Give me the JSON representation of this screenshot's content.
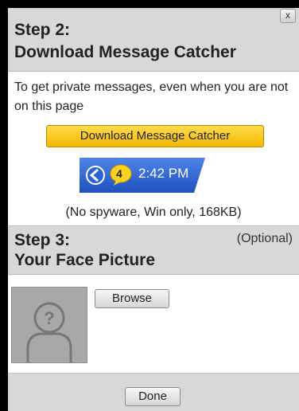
{
  "step2": {
    "title_line1": "Step 2:",
    "title_line2": "Download Message Catcher",
    "close_label": "x",
    "description": "To get private messages, even when you are not on this page",
    "download_button": "Download Message Catcher",
    "taskbar_count": "4",
    "taskbar_time": "2:42 PM",
    "specs": "(No spyware, Win only, 168KB)"
  },
  "step3": {
    "title_line1": "Step 3:",
    "title_line2": "Your Face Picture",
    "optional_label": "(Optional)",
    "browse_button": "Browse"
  },
  "footer": {
    "done_button": "Done"
  },
  "colors": {
    "header_bg": "#d8d8d8",
    "download_button": "#f4b800",
    "taskbar_blue": "#2a5fd6"
  },
  "icons": [
    "close-icon",
    "back-arrow-icon",
    "message-bubble-icon",
    "avatar-placeholder-icon"
  ]
}
